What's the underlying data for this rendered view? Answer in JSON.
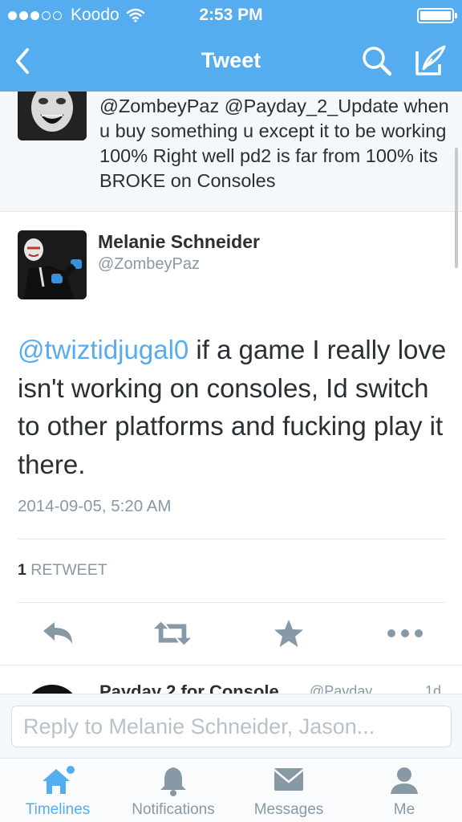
{
  "status_bar": {
    "carrier": "Koodo",
    "time": "2:53 PM"
  },
  "nav": {
    "title": "Tweet"
  },
  "previous_tweet": {
    "text": "@ZombeyPaz @Payday_2_Update when u buy something u except it to be working 100% Right well pd2 is far from 100% its BROKE on Consoles"
  },
  "tweet": {
    "author_name": "Melanie Schneider",
    "author_handle": "@ZombeyPaz",
    "mention": "@twiztidjugal0",
    "text": " if a game I really love isn't working on consoles, Id switch to other platforms and fucking play it there.",
    "timestamp": "2014-09-05, 5:20 AM",
    "retweet_count": "1",
    "retweet_label": "RETWEET"
  },
  "next_tweet": {
    "author_name": "Payday 2 for Console",
    "author_handle": "@Payday...",
    "time": "1d"
  },
  "reply": {
    "placeholder": "Reply to Melanie Schneider, Jason..."
  },
  "tabs": [
    {
      "label": "Timelines",
      "icon": "home-icon",
      "active": true
    },
    {
      "label": "Notifications",
      "icon": "bell-icon",
      "active": false
    },
    {
      "label": "Messages",
      "icon": "envelope-icon",
      "active": false
    },
    {
      "label": "Me",
      "icon": "person-icon",
      "active": false
    }
  ],
  "colors": {
    "brand": "#55acee",
    "text": "#292f33",
    "muted": "#8899a6"
  }
}
